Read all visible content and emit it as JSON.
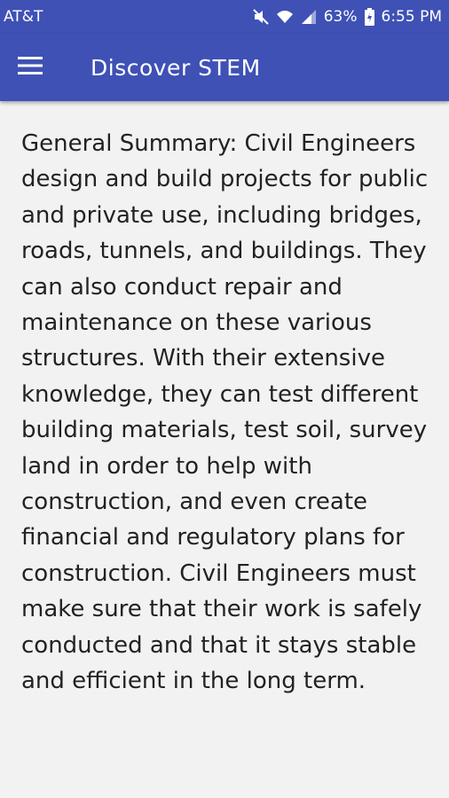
{
  "status_bar": {
    "carrier": "AT&T",
    "battery": "63%",
    "time": "6:55 PM"
  },
  "app_bar": {
    "title": "Discover STEM",
    "menu_icon": "hamburger-menu-icon"
  },
  "content": {
    "summary": "General Summary: Civil Engineers design and build projects for public and private use, including bridges, roads, tunnels, and buildings. They can also conduct repair and maintenance on these various structures. With their extensive knowledge, they can test different building materials, test soil, survey land in order to help with construction, and even create financial and regulatory plans for construction. Civil Engineers must make sure that their work is safely conducted and that it stays stable and efficient in the long term."
  },
  "colors": {
    "primary": "#3f51b5",
    "background": "#f2f2f2",
    "text": "#222222"
  }
}
